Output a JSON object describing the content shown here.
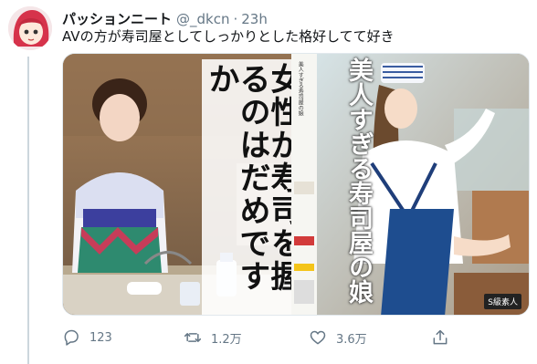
{
  "tweet": {
    "display_name": "パッションニート",
    "handle": "@_dkcn",
    "separator": "·",
    "time": "23h",
    "text": "AVの方が寿司屋としてしっかりとした格好してて好き"
  },
  "media": {
    "left_title": "女性が寿司を握るのはだめですか",
    "right_title": "美人すぎる寿司屋の娘",
    "spine_text": "美人すぎる寿司屋の娘",
    "label": "S級素人"
  },
  "actions": {
    "reply_count": "123",
    "retweet_count": "1.2万",
    "like_count": "3.6万"
  },
  "colors": {
    "secondary_text": "#657786",
    "thread_line": "#ccd6dd"
  }
}
